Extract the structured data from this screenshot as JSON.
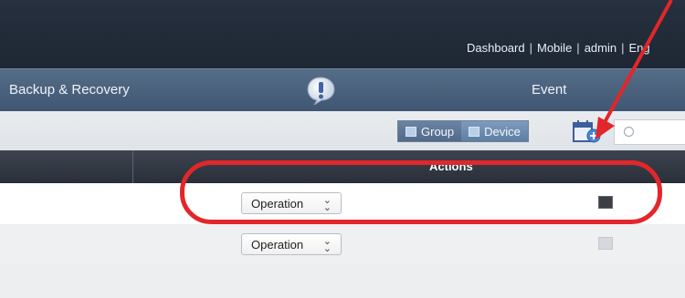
{
  "topbar": {
    "links": [
      "Dashboard",
      "Mobile",
      "admin",
      "Eng"
    ]
  },
  "navbar": {
    "backup_label": "Backup & Recovery",
    "event_label": "Event",
    "event_icon": "exclamation-bubble-icon"
  },
  "toolbar": {
    "group_label": "Group",
    "device_label": "Device",
    "add_device_icon": "add-device-icon",
    "search_placeholder": ""
  },
  "table": {
    "actions_header": "Actions",
    "rows": [
      {
        "operation_label": "Operation",
        "icon": "monitor-icon"
      },
      {
        "operation_label": "Operation",
        "icon": "monitor-icon"
      }
    ]
  },
  "annotation": {
    "color": "#e3262a"
  }
}
